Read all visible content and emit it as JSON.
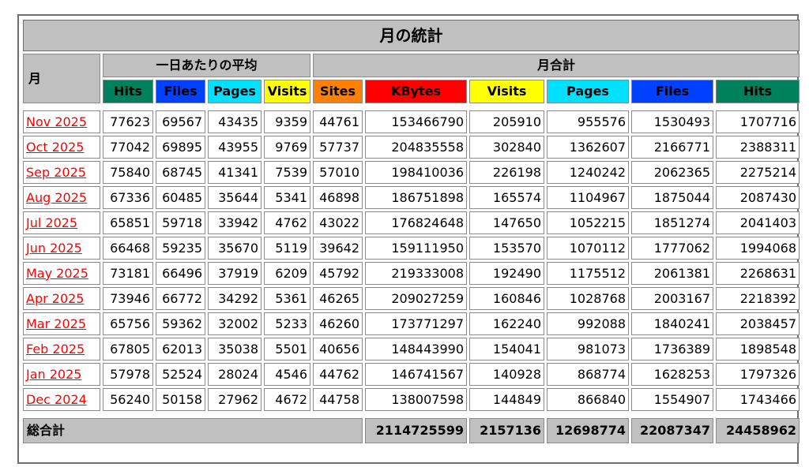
{
  "title": "月の統計",
  "month_header": "月",
  "daily_avg_header": "一日あたりの平均",
  "monthly_total_header": "月合計",
  "columns_daily": [
    "Hits",
    "Files",
    "Pages",
    "Visits"
  ],
  "columns_total": [
    "Sites",
    "KBytes",
    "Visits",
    "Pages",
    "Files",
    "Hits"
  ],
  "colors": {
    "hits": "#00805c",
    "files": "#0040ff",
    "pages": "#00e0ff",
    "visits": "#ffff00",
    "sites": "#ff8000",
    "kbytes": "#ff0000",
    "month_link": "#ff0000",
    "header_grey": "#c0c0c0"
  },
  "rows": [
    {
      "month": "Nov 2025",
      "avg_hits": "77623",
      "avg_files": "69567",
      "avg_pages": "43435",
      "avg_visits": "9359",
      "sites": "44761",
      "kbytes": "153466790",
      "visits": "205910",
      "pages": "955576",
      "files": "1530493",
      "hits": "1707716"
    },
    {
      "month": "Oct 2025",
      "avg_hits": "77042",
      "avg_files": "69895",
      "avg_pages": "43955",
      "avg_visits": "9769",
      "sites": "57737",
      "kbytes": "204835558",
      "visits": "302840",
      "pages": "1362607",
      "files": "2166771",
      "hits": "2388311"
    },
    {
      "month": "Sep 2025",
      "avg_hits": "75840",
      "avg_files": "68745",
      "avg_pages": "41341",
      "avg_visits": "7539",
      "sites": "57010",
      "kbytes": "198410036",
      "visits": "226198",
      "pages": "1240242",
      "files": "2062365",
      "hits": "2275214"
    },
    {
      "month": "Aug 2025",
      "avg_hits": "67336",
      "avg_files": "60485",
      "avg_pages": "35644",
      "avg_visits": "5341",
      "sites": "46898",
      "kbytes": "186751898",
      "visits": "165574",
      "pages": "1104967",
      "files": "1875044",
      "hits": "2087430"
    },
    {
      "month": "Jul 2025",
      "avg_hits": "65851",
      "avg_files": "59718",
      "avg_pages": "33942",
      "avg_visits": "4762",
      "sites": "43022",
      "kbytes": "176824648",
      "visits": "147650",
      "pages": "1052215",
      "files": "1851274",
      "hits": "2041403"
    },
    {
      "month": "Jun 2025",
      "avg_hits": "66468",
      "avg_files": "59235",
      "avg_pages": "35670",
      "avg_visits": "5119",
      "sites": "39642",
      "kbytes": "159111950",
      "visits": "153570",
      "pages": "1070112",
      "files": "1777062",
      "hits": "1994068"
    },
    {
      "month": "May 2025",
      "avg_hits": "73181",
      "avg_files": "66496",
      "avg_pages": "37919",
      "avg_visits": "6209",
      "sites": "45792",
      "kbytes": "219333008",
      "visits": "192490",
      "pages": "1175512",
      "files": "2061381",
      "hits": "2268631"
    },
    {
      "month": "Apr 2025",
      "avg_hits": "73946",
      "avg_files": "66772",
      "avg_pages": "34292",
      "avg_visits": "5361",
      "sites": "46265",
      "kbytes": "209027259",
      "visits": "160846",
      "pages": "1028768",
      "files": "2003167",
      "hits": "2218392"
    },
    {
      "month": "Mar 2025",
      "avg_hits": "65756",
      "avg_files": "59362",
      "avg_pages": "32002",
      "avg_visits": "5233",
      "sites": "46260",
      "kbytes": "173771297",
      "visits": "162240",
      "pages": "992088",
      "files": "1840241",
      "hits": "2038457"
    },
    {
      "month": "Feb 2025",
      "avg_hits": "67805",
      "avg_files": "62013",
      "avg_pages": "35038",
      "avg_visits": "5501",
      "sites": "40656",
      "kbytes": "148443990",
      "visits": "154041",
      "pages": "981073",
      "files": "1736389",
      "hits": "1898548"
    },
    {
      "month": "Jan 2025",
      "avg_hits": "57978",
      "avg_files": "52524",
      "avg_pages": "28024",
      "avg_visits": "4546",
      "sites": "44762",
      "kbytes": "146741567",
      "visits": "140928",
      "pages": "868774",
      "files": "1628253",
      "hits": "1797326"
    },
    {
      "month": "Dec 2024",
      "avg_hits": "56240",
      "avg_files": "50158",
      "avg_pages": "27962",
      "avg_visits": "4672",
      "sites": "44758",
      "kbytes": "138007598",
      "visits": "144849",
      "pages": "866840",
      "files": "1554907",
      "hits": "1743466"
    }
  ],
  "totals": {
    "label": "総合計",
    "kbytes": "2114725599",
    "visits": "2157136",
    "pages": "12698774",
    "files": "22087347",
    "hits": "24458962"
  }
}
